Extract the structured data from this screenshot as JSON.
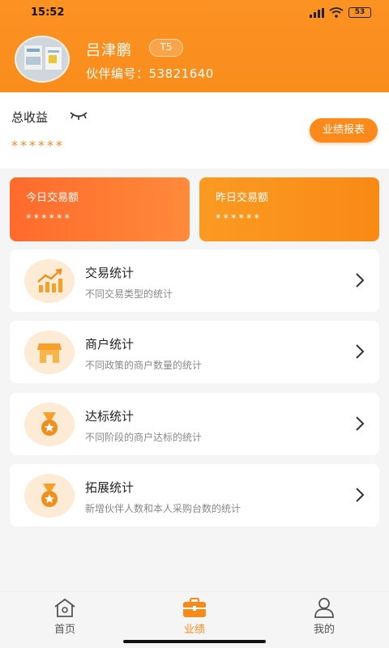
{
  "status_bar": {
    "time": "15:52",
    "battery": "53"
  },
  "profile": {
    "name": "吕津鹏",
    "level": "T5",
    "partner_id": "伙伴编号：53821640"
  },
  "summary": {
    "total_label": "总收益",
    "total_value": "******",
    "report_button": "业绩报表"
  },
  "cards": {
    "today": {
      "label": "今日交易额",
      "value": "******"
    },
    "yesterday": {
      "label": "昨日交易额",
      "value": "******"
    }
  },
  "menu": [
    {
      "title": "交易统计",
      "subtitle": "不同交易类型的统计",
      "icon": "trend-chart-icon"
    },
    {
      "title": "商户统计",
      "subtitle": "不同政策的商户数量的统计",
      "icon": "store-icon"
    },
    {
      "title": "达标统计",
      "subtitle": "不同阶段的商户达标的统计",
      "icon": "medal-icon"
    },
    {
      "title": "拓展统计",
      "subtitle": "新增伙伴人数和本人采购台数的统计",
      "icon": "medal-icon"
    }
  ],
  "tabs": [
    {
      "label": "首页",
      "icon": "home-icon"
    },
    {
      "label": "业绩",
      "icon": "briefcase-icon",
      "active": true
    },
    {
      "label": "我的",
      "icon": "user-icon"
    }
  ],
  "colors": {
    "accent": "#f98d1c",
    "card_today": "#ff6a2c",
    "card_yesterday": "#f98a14"
  }
}
